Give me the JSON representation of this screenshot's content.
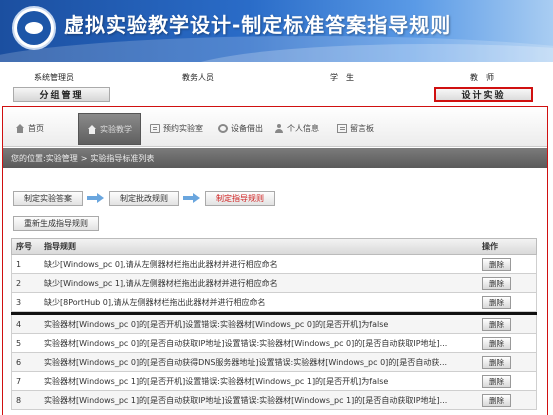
{
  "header": {
    "title": "虚拟实验教学设计-制定标准答案指导规则"
  },
  "roles": [
    "系统管理员",
    "教务人员",
    "学　生",
    "教　师"
  ],
  "subnav": {
    "left": "分组管理",
    "right": "设计实验"
  },
  "nav": [
    {
      "label": "首页",
      "icon": "home-icon"
    },
    {
      "label": "实验教学",
      "icon": "home-icon"
    },
    {
      "label": "预约实验室",
      "icon": "box-icon"
    },
    {
      "label": "设备借出",
      "icon": "gear-icon"
    },
    {
      "label": "个人信息",
      "icon": "user-icon"
    },
    {
      "label": "留言板",
      "icon": "doc-icon"
    }
  ],
  "breadcrumb": {
    "prefix": "您的位置:",
    "parent": "实验管理",
    "sep": ">",
    "current": "实验指导标准列表"
  },
  "steps": [
    "制定实验答案",
    "制定批改规则",
    "制定指导规则"
  ],
  "regen_button": "重新生成指导规则",
  "table": {
    "headers": [
      "序号",
      "指导规则",
      "操作"
    ],
    "delete_label": "删除",
    "rows": [
      [
        "1",
        "缺少[Windows_pc 0],请从左侧器材栏拖出此器材并进行相应命名"
      ],
      [
        "2",
        "缺少[Windows_pc 1],请从左侧器材栏拖出此器材并进行相应命名"
      ],
      [
        "3",
        "缺少[8PortHub 0],请从左侧器材栏拖出此器材并进行相应命名"
      ],
      [
        "4",
        "实验器材[Windows_pc 0]的[是否开机]设置错误:实验器材[Windows_pc 0]的[是否开机]为false"
      ],
      [
        "5",
        "实验器材[Windows_pc 0]的[是否自动获取IP地址]设置错误:实验器材[Windows_pc 0]的[是否自动获取IP地址]..."
      ],
      [
        "6",
        "实验器材[Windows_pc 0]的[是否自动获得DNS服务器地址]设置错误:实验器材[Windows_pc 0]的[是否自动获..."
      ],
      [
        "7",
        "实验器材[Windows_pc 1]的[是否开机]设置错误:实验器材[Windows_pc 1]的[是否开机]为false"
      ],
      [
        "8",
        "实验器材[Windows_pc 1]的[是否自动获取IP地址]设置错误:实验器材[Windows_pc 1]的[是否自动获取IP地址]..."
      ]
    ]
  }
}
